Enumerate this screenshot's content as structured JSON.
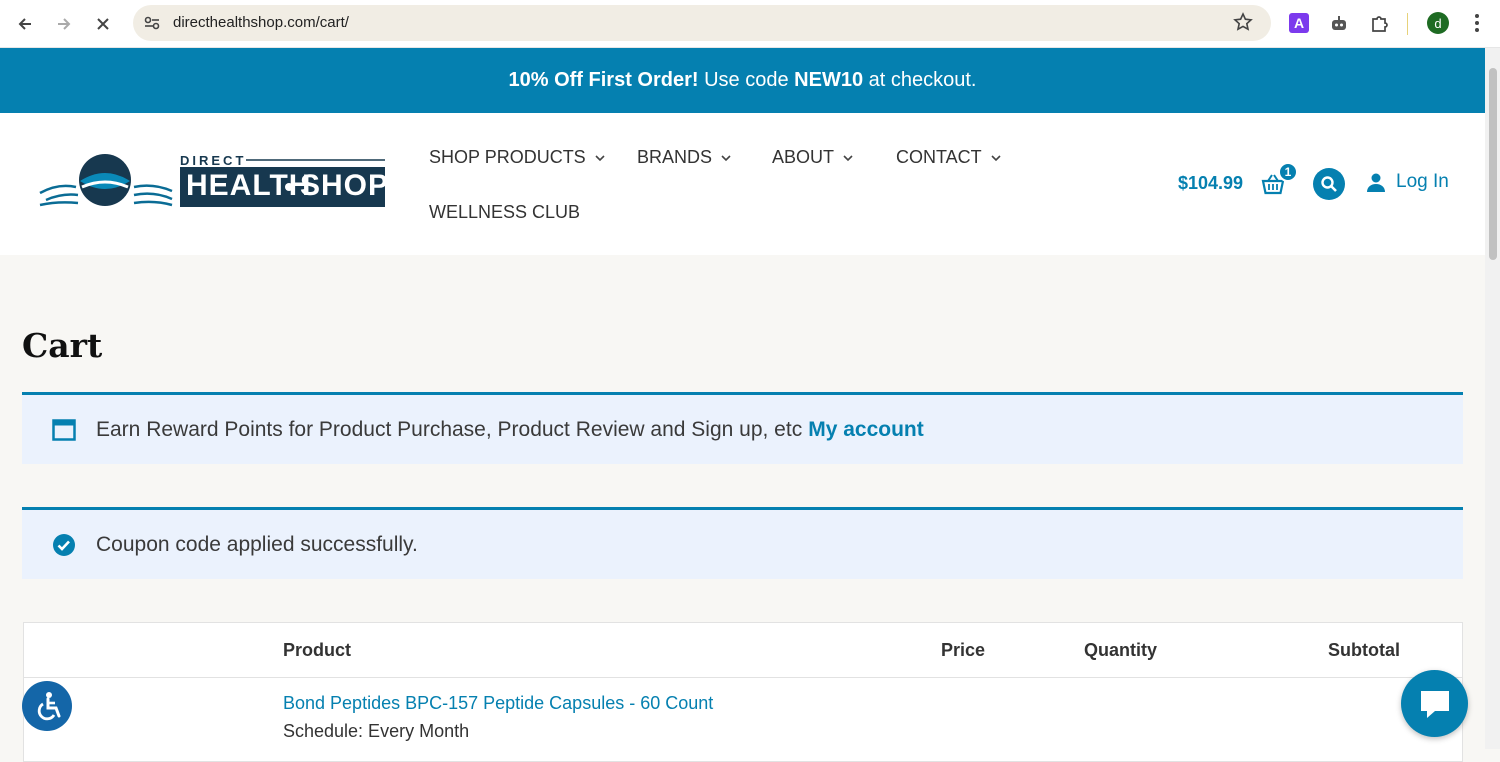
{
  "browser": {
    "url": "directhealthshop.com/cart/",
    "avatar_letter": "d",
    "ext_letter": "A"
  },
  "promo": {
    "bold1": "10% Off First Order!",
    "text1": "Use code",
    "code": "NEW10",
    "text2": "at checkout."
  },
  "logo": {
    "small": "DIRECT",
    "big_left": "HEALTH",
    "big_right": "SHOP"
  },
  "nav": {
    "items": [
      {
        "label": "SHOP PRODUCTS"
      },
      {
        "label": "BRANDS"
      },
      {
        "label": "ABOUT"
      },
      {
        "label": "CONTACT"
      },
      {
        "label": "WELLNESS CLUB"
      }
    ]
  },
  "header": {
    "cart_total": "$104.99",
    "cart_count": "1",
    "login_label": "Log In"
  },
  "page": {
    "title": "Cart",
    "reward_text": "Earn Reward Points for Product Purchase, Product Review and Sign up, etc",
    "reward_link": "My account",
    "coupon_text": "Coupon code applied successfully."
  },
  "table": {
    "headers": {
      "product": "Product",
      "price": "Price",
      "quantity": "Quantity",
      "subtotal": "Subtotal"
    },
    "rows": [
      {
        "product": "Bond Peptides BPC-157 Peptide Capsules - 60 Count",
        "schedule": "Schedule: Every Month"
      }
    ]
  },
  "colors": {
    "brand": "#0580b0",
    "notice_bg": "#ebf2fd"
  }
}
